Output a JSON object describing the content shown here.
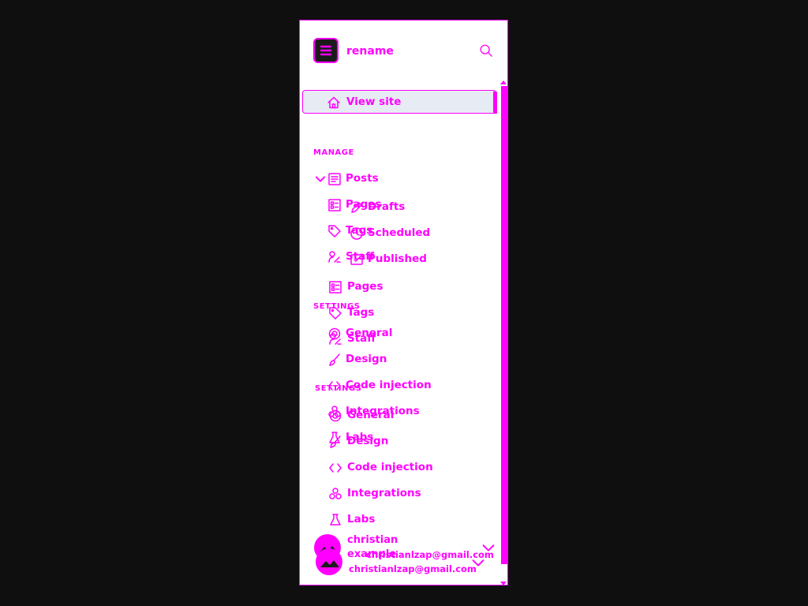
{
  "site": {
    "name": "rename",
    "view_site_label": "View site"
  },
  "manage": {
    "header": "MANAGE",
    "posts_label": "Posts",
    "posts_subitems": [
      "Drafts",
      "Scheduled",
      "Published"
    ],
    "items": [
      "Pages",
      "Tags",
      "Staff"
    ]
  },
  "settings": {
    "header": "SETTINGS",
    "items": [
      "General",
      "Design",
      "Code injection",
      "Integrations",
      "Labs"
    ]
  },
  "user": {
    "name": "christian",
    "extra": "example",
    "email": "christianlzap@gmail.com"
  },
  "colors": {
    "accent": "#ff00ff",
    "background": "#0f0f0f",
    "panel": "#ffffff",
    "selected": "#e7ecf4"
  }
}
